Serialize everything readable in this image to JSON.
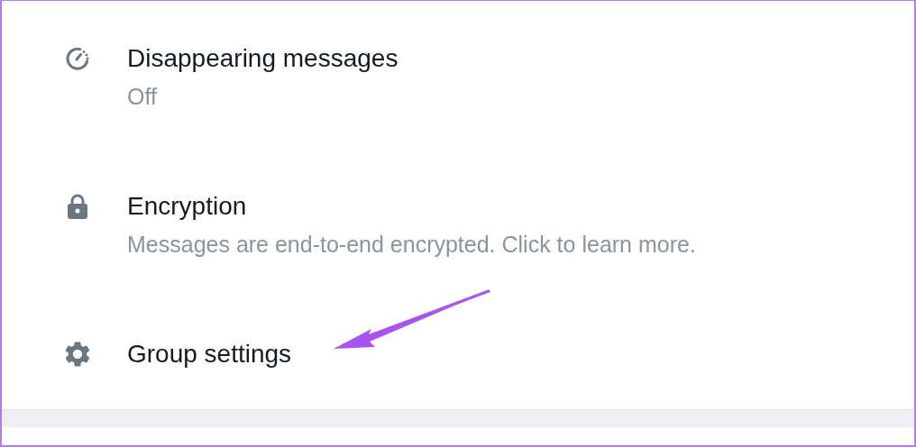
{
  "settings": [
    {
      "kind": "timer",
      "title": "Disappearing messages",
      "subtitle": "Off"
    },
    {
      "kind": "lock",
      "title": "Encryption",
      "subtitle": "Messages are end-to-end encrypted. Click to learn more."
    },
    {
      "kind": "gear",
      "title": "Group settings"
    }
  ]
}
